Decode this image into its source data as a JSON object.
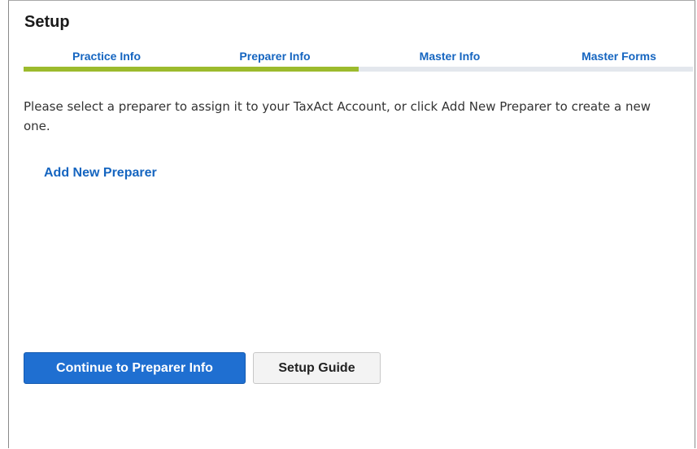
{
  "page": {
    "title": "Setup",
    "instructions": "Please select a preparer to assign it to your TaxAct Account, or click Add New Preparer to create a new one."
  },
  "steps": {
    "items": [
      {
        "label": "Practice Info",
        "state": "complete"
      },
      {
        "label": "Preparer Info",
        "state": "current"
      },
      {
        "label": "Master Info",
        "state": "pending"
      },
      {
        "label": "Master Forms",
        "state": "pending"
      }
    ],
    "progress_fraction": 0.5,
    "colors": {
      "filled": "#9cbb2d",
      "track": "#e3e7ed",
      "label": "#1565c0"
    }
  },
  "actions": {
    "add_new_preparer": "Add New Preparer",
    "continue_button": "Continue to Preparer Info",
    "setup_guide_button": "Setup Guide"
  },
  "colors": {
    "primary": "#1f6fd1",
    "link": "#1565c0"
  }
}
